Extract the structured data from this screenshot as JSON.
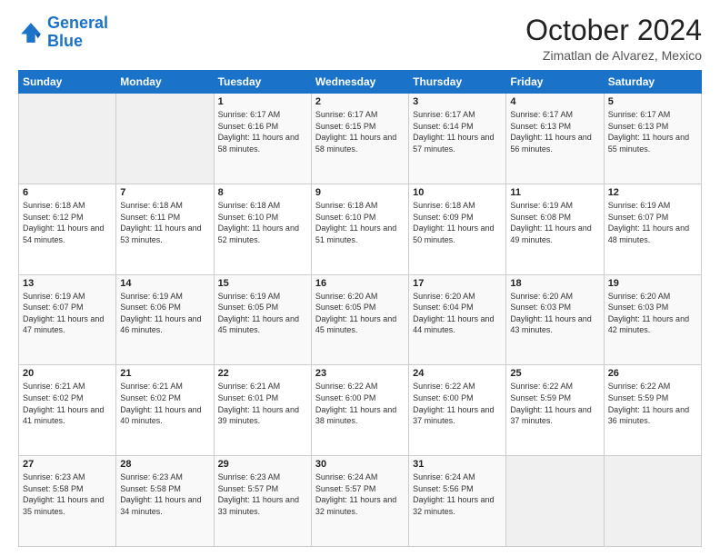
{
  "logo": {
    "line1": "General",
    "line2": "Blue"
  },
  "header": {
    "title": "October 2024",
    "location": "Zimatlan de Alvarez, Mexico"
  },
  "weekdays": [
    "Sunday",
    "Monday",
    "Tuesday",
    "Wednesday",
    "Thursday",
    "Friday",
    "Saturday"
  ],
  "weeks": [
    [
      {
        "day": "",
        "info": ""
      },
      {
        "day": "",
        "info": ""
      },
      {
        "day": "1",
        "info": "Sunrise: 6:17 AM\nSunset: 6:16 PM\nDaylight: 11 hours and 58 minutes."
      },
      {
        "day": "2",
        "info": "Sunrise: 6:17 AM\nSunset: 6:15 PM\nDaylight: 11 hours and 58 minutes."
      },
      {
        "day": "3",
        "info": "Sunrise: 6:17 AM\nSunset: 6:14 PM\nDaylight: 11 hours and 57 minutes."
      },
      {
        "day": "4",
        "info": "Sunrise: 6:17 AM\nSunset: 6:13 PM\nDaylight: 11 hours and 56 minutes."
      },
      {
        "day": "5",
        "info": "Sunrise: 6:17 AM\nSunset: 6:13 PM\nDaylight: 11 hours and 55 minutes."
      }
    ],
    [
      {
        "day": "6",
        "info": "Sunrise: 6:18 AM\nSunset: 6:12 PM\nDaylight: 11 hours and 54 minutes."
      },
      {
        "day": "7",
        "info": "Sunrise: 6:18 AM\nSunset: 6:11 PM\nDaylight: 11 hours and 53 minutes."
      },
      {
        "day": "8",
        "info": "Sunrise: 6:18 AM\nSunset: 6:10 PM\nDaylight: 11 hours and 52 minutes."
      },
      {
        "day": "9",
        "info": "Sunrise: 6:18 AM\nSunset: 6:10 PM\nDaylight: 11 hours and 51 minutes."
      },
      {
        "day": "10",
        "info": "Sunrise: 6:18 AM\nSunset: 6:09 PM\nDaylight: 11 hours and 50 minutes."
      },
      {
        "day": "11",
        "info": "Sunrise: 6:19 AM\nSunset: 6:08 PM\nDaylight: 11 hours and 49 minutes."
      },
      {
        "day": "12",
        "info": "Sunrise: 6:19 AM\nSunset: 6:07 PM\nDaylight: 11 hours and 48 minutes."
      }
    ],
    [
      {
        "day": "13",
        "info": "Sunrise: 6:19 AM\nSunset: 6:07 PM\nDaylight: 11 hours and 47 minutes."
      },
      {
        "day": "14",
        "info": "Sunrise: 6:19 AM\nSunset: 6:06 PM\nDaylight: 11 hours and 46 minutes."
      },
      {
        "day": "15",
        "info": "Sunrise: 6:19 AM\nSunset: 6:05 PM\nDaylight: 11 hours and 45 minutes."
      },
      {
        "day": "16",
        "info": "Sunrise: 6:20 AM\nSunset: 6:05 PM\nDaylight: 11 hours and 45 minutes."
      },
      {
        "day": "17",
        "info": "Sunrise: 6:20 AM\nSunset: 6:04 PM\nDaylight: 11 hours and 44 minutes."
      },
      {
        "day": "18",
        "info": "Sunrise: 6:20 AM\nSunset: 6:03 PM\nDaylight: 11 hours and 43 minutes."
      },
      {
        "day": "19",
        "info": "Sunrise: 6:20 AM\nSunset: 6:03 PM\nDaylight: 11 hours and 42 minutes."
      }
    ],
    [
      {
        "day": "20",
        "info": "Sunrise: 6:21 AM\nSunset: 6:02 PM\nDaylight: 11 hours and 41 minutes."
      },
      {
        "day": "21",
        "info": "Sunrise: 6:21 AM\nSunset: 6:02 PM\nDaylight: 11 hours and 40 minutes."
      },
      {
        "day": "22",
        "info": "Sunrise: 6:21 AM\nSunset: 6:01 PM\nDaylight: 11 hours and 39 minutes."
      },
      {
        "day": "23",
        "info": "Sunrise: 6:22 AM\nSunset: 6:00 PM\nDaylight: 11 hours and 38 minutes."
      },
      {
        "day": "24",
        "info": "Sunrise: 6:22 AM\nSunset: 6:00 PM\nDaylight: 11 hours and 37 minutes."
      },
      {
        "day": "25",
        "info": "Sunrise: 6:22 AM\nSunset: 5:59 PM\nDaylight: 11 hours and 37 minutes."
      },
      {
        "day": "26",
        "info": "Sunrise: 6:22 AM\nSunset: 5:59 PM\nDaylight: 11 hours and 36 minutes."
      }
    ],
    [
      {
        "day": "27",
        "info": "Sunrise: 6:23 AM\nSunset: 5:58 PM\nDaylight: 11 hours and 35 minutes."
      },
      {
        "day": "28",
        "info": "Sunrise: 6:23 AM\nSunset: 5:58 PM\nDaylight: 11 hours and 34 minutes."
      },
      {
        "day": "29",
        "info": "Sunrise: 6:23 AM\nSunset: 5:57 PM\nDaylight: 11 hours and 33 minutes."
      },
      {
        "day": "30",
        "info": "Sunrise: 6:24 AM\nSunset: 5:57 PM\nDaylight: 11 hours and 32 minutes."
      },
      {
        "day": "31",
        "info": "Sunrise: 6:24 AM\nSunset: 5:56 PM\nDaylight: 11 hours and 32 minutes."
      },
      {
        "day": "",
        "info": ""
      },
      {
        "day": "",
        "info": ""
      }
    ]
  ]
}
